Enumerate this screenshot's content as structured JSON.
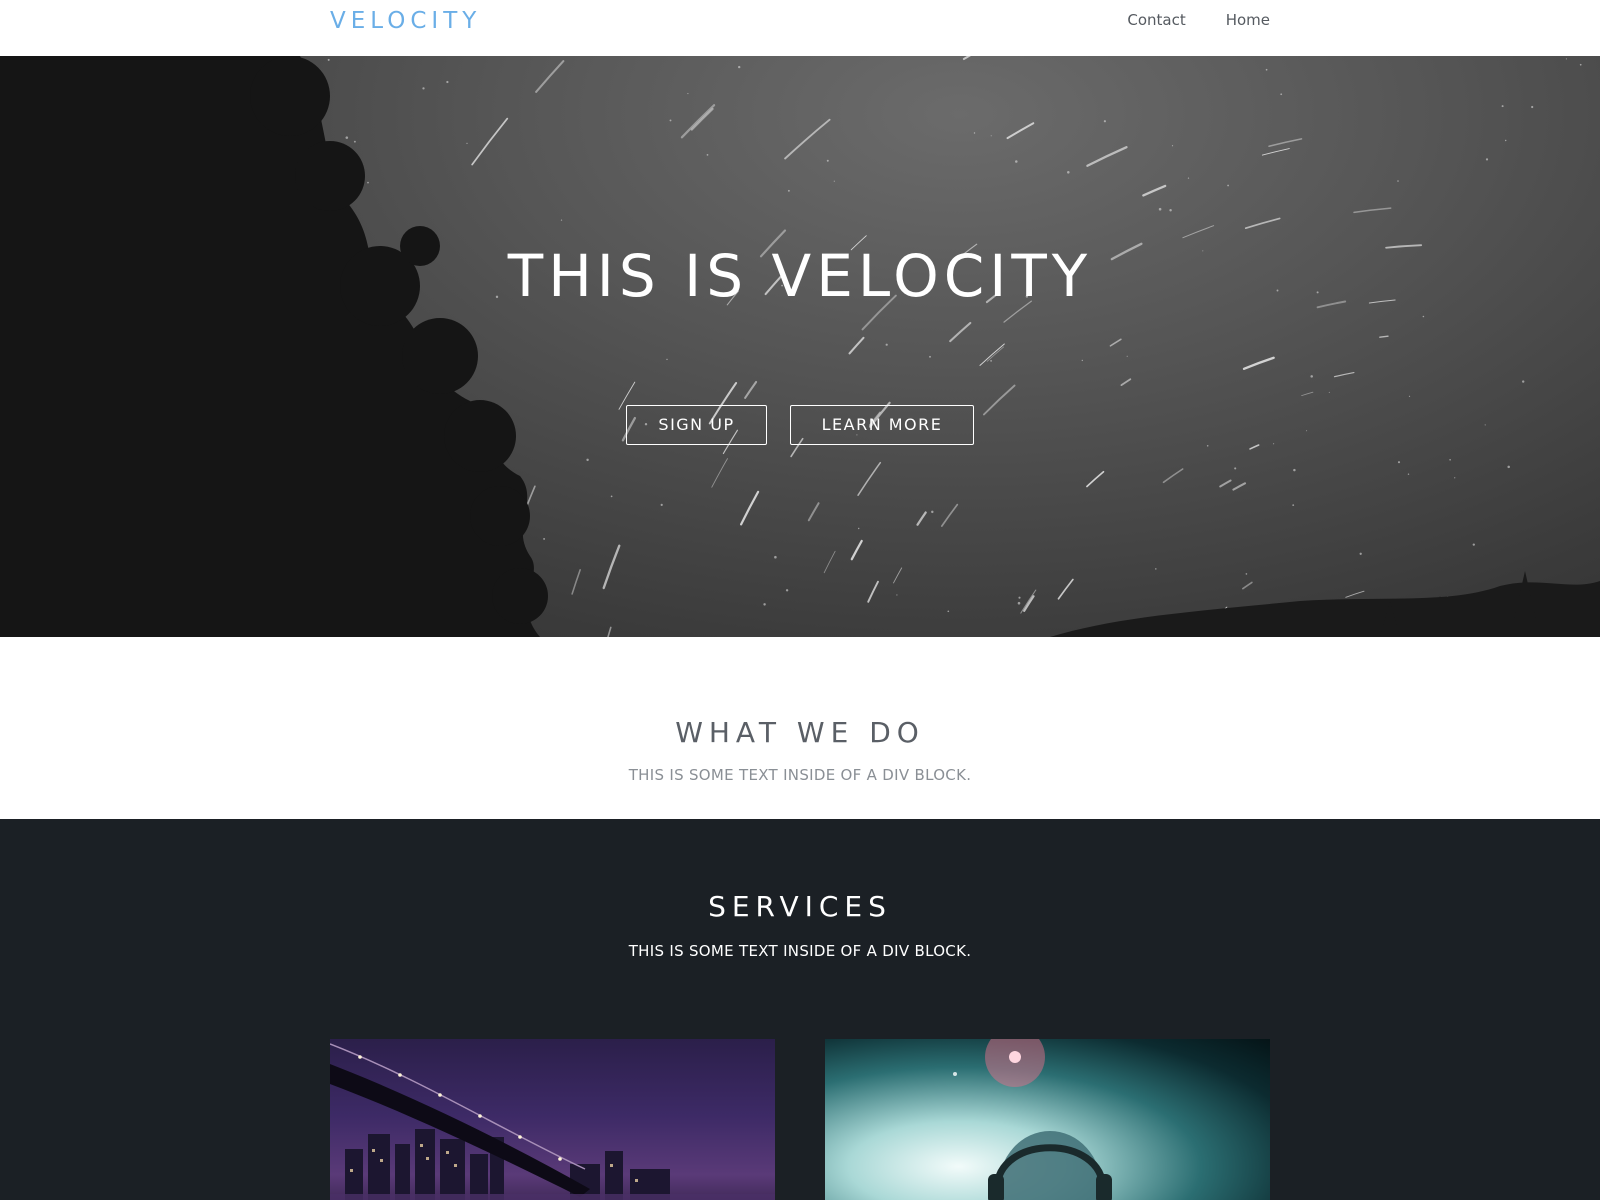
{
  "navbar": {
    "brand": "VELOCITY",
    "links": [
      {
        "label": "Contact"
      },
      {
        "label": "Home"
      }
    ],
    "brand_color": "#6aaee7"
  },
  "hero": {
    "title": "THIS IS VELOCITY",
    "buttons": [
      {
        "label": "SIGN UP"
      },
      {
        "label": "LEARN MORE"
      }
    ],
    "background": "star-trails-night-sky-photo"
  },
  "what_we_do": {
    "title": "WHAT WE DO",
    "subtitle": "THIS IS SOME TEXT INSIDE OF A DIV BLOCK."
  },
  "services": {
    "title": "SERVICES",
    "subtitle": "THIS IS SOME TEXT INSIDE OF A DIV BLOCK.",
    "background_color": "#1b2025",
    "cards": [
      {
        "image": "bridge-city-night-photo"
      },
      {
        "image": "dj-headphones-stage-lights-photo"
      }
    ]
  }
}
